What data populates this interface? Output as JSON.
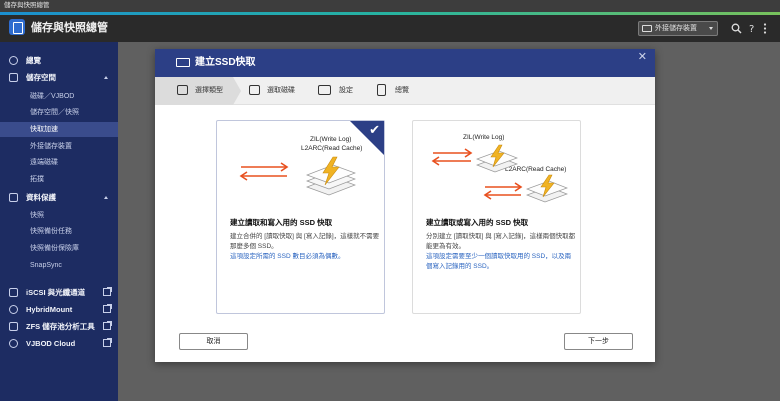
{
  "window": {
    "title": "儲存與快照總管"
  },
  "header": {
    "app_title": "儲存與快照總管",
    "external_storage_btn": "外接儲存裝置"
  },
  "sidebar": {
    "items": [
      {
        "label": "總覽",
        "level": "top",
        "icon": "dashboard-icon"
      },
      {
        "label": "儲存空間",
        "level": "top",
        "icon": "storage-icon",
        "expanded": true
      },
      {
        "label": "磁碟／VJBOD",
        "level": "sub"
      },
      {
        "label": "儲存空間／快照",
        "level": "sub"
      },
      {
        "label": "快取加速",
        "level": "sub",
        "active": true
      },
      {
        "label": "外接儲存裝置",
        "level": "sub"
      },
      {
        "label": "遠端磁碟",
        "level": "sub"
      },
      {
        "label": "拓撲",
        "level": "sub"
      },
      {
        "label": "資料保護",
        "level": "top",
        "icon": "protection-icon",
        "expanded": true
      },
      {
        "label": "快照",
        "level": "sub"
      },
      {
        "label": "快照備份任務",
        "level": "sub"
      },
      {
        "label": "快照備份保險庫",
        "level": "sub"
      },
      {
        "label": "SnapSync",
        "level": "sub"
      },
      {
        "label": "iSCSI 與光纖通道",
        "level": "top",
        "icon": "iscsi-icon",
        "external": true
      },
      {
        "label": "HybridMount",
        "level": "top",
        "icon": "hybridmount-icon",
        "external": true
      },
      {
        "label": "ZFS 儲存池分析工具",
        "level": "top",
        "icon": "zfs-icon",
        "external": true
      },
      {
        "label": "VJBOD Cloud",
        "level": "top",
        "icon": "cloud-icon",
        "external": true
      }
    ]
  },
  "dialog": {
    "title": "建立SSD快取",
    "steps": [
      {
        "label": "選擇類型",
        "active": true
      },
      {
        "label": "選取磁碟"
      },
      {
        "label": "設定"
      },
      {
        "label": "總覽"
      }
    ],
    "cards": [
      {
        "selected": true,
        "zil_label": "ZIL(Write Log)",
        "l2arc_label": "L2ARC(Read Cache)",
        "title": "建立讀取和寫入用的 SSD 快取",
        "desc": "建立合併的 [讀取快取] 與 [寫入記錄]，這樣就不需要那麼多個 SSD。",
        "note": "這項設定所需的 SSD 數目必須為偶數。"
      },
      {
        "selected": false,
        "zil_label": "ZIL(Write Log)",
        "l2arc_label": "L2ARC(Read Cache)",
        "title": "建立讀取或寫入用的 SSD 快取",
        "desc": "分別建立 [讀取快取] 與 [寫入記錄]，這樣兩個快取都能更為有效。",
        "note": "這項設定需要至少一個讀取快取用的 SSD，以及兩個寫入記錄用的 SSD。"
      }
    ],
    "cancel_label": "取消",
    "next_label": "下一步"
  },
  "colors": {
    "sidebar_bg": "#1d2c62",
    "dialog_header": "#2c3f86",
    "arrow_orange": "#e8501f",
    "bolt_yellow": "#f0b324",
    "note_blue": "#2a64c0"
  }
}
